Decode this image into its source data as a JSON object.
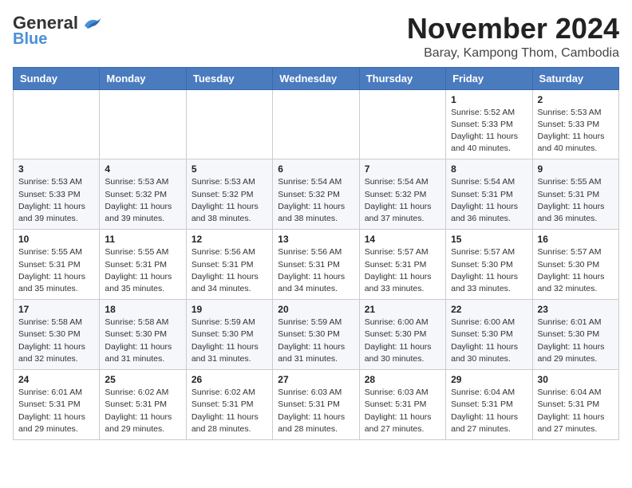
{
  "logo": {
    "general": "General",
    "blue": "Blue"
  },
  "title": "November 2024",
  "location": "Baray, Kampong Thom, Cambodia",
  "weekdays": [
    "Sunday",
    "Monday",
    "Tuesday",
    "Wednesday",
    "Thursday",
    "Friday",
    "Saturday"
  ],
  "weeks": [
    [
      {
        "day": "",
        "info": ""
      },
      {
        "day": "",
        "info": ""
      },
      {
        "day": "",
        "info": ""
      },
      {
        "day": "",
        "info": ""
      },
      {
        "day": "",
        "info": ""
      },
      {
        "day": "1",
        "info": "Sunrise: 5:52 AM\nSunset: 5:33 PM\nDaylight: 11 hours\nand 40 minutes."
      },
      {
        "day": "2",
        "info": "Sunrise: 5:53 AM\nSunset: 5:33 PM\nDaylight: 11 hours\nand 40 minutes."
      }
    ],
    [
      {
        "day": "3",
        "info": "Sunrise: 5:53 AM\nSunset: 5:33 PM\nDaylight: 11 hours\nand 39 minutes."
      },
      {
        "day": "4",
        "info": "Sunrise: 5:53 AM\nSunset: 5:32 PM\nDaylight: 11 hours\nand 39 minutes."
      },
      {
        "day": "5",
        "info": "Sunrise: 5:53 AM\nSunset: 5:32 PM\nDaylight: 11 hours\nand 38 minutes."
      },
      {
        "day": "6",
        "info": "Sunrise: 5:54 AM\nSunset: 5:32 PM\nDaylight: 11 hours\nand 38 minutes."
      },
      {
        "day": "7",
        "info": "Sunrise: 5:54 AM\nSunset: 5:32 PM\nDaylight: 11 hours\nand 37 minutes."
      },
      {
        "day": "8",
        "info": "Sunrise: 5:54 AM\nSunset: 5:31 PM\nDaylight: 11 hours\nand 36 minutes."
      },
      {
        "day": "9",
        "info": "Sunrise: 5:55 AM\nSunset: 5:31 PM\nDaylight: 11 hours\nand 36 minutes."
      }
    ],
    [
      {
        "day": "10",
        "info": "Sunrise: 5:55 AM\nSunset: 5:31 PM\nDaylight: 11 hours\nand 35 minutes."
      },
      {
        "day": "11",
        "info": "Sunrise: 5:55 AM\nSunset: 5:31 PM\nDaylight: 11 hours\nand 35 minutes."
      },
      {
        "day": "12",
        "info": "Sunrise: 5:56 AM\nSunset: 5:31 PM\nDaylight: 11 hours\nand 34 minutes."
      },
      {
        "day": "13",
        "info": "Sunrise: 5:56 AM\nSunset: 5:31 PM\nDaylight: 11 hours\nand 34 minutes."
      },
      {
        "day": "14",
        "info": "Sunrise: 5:57 AM\nSunset: 5:31 PM\nDaylight: 11 hours\nand 33 minutes."
      },
      {
        "day": "15",
        "info": "Sunrise: 5:57 AM\nSunset: 5:30 PM\nDaylight: 11 hours\nand 33 minutes."
      },
      {
        "day": "16",
        "info": "Sunrise: 5:57 AM\nSunset: 5:30 PM\nDaylight: 11 hours\nand 32 minutes."
      }
    ],
    [
      {
        "day": "17",
        "info": "Sunrise: 5:58 AM\nSunset: 5:30 PM\nDaylight: 11 hours\nand 32 minutes."
      },
      {
        "day": "18",
        "info": "Sunrise: 5:58 AM\nSunset: 5:30 PM\nDaylight: 11 hours\nand 31 minutes."
      },
      {
        "day": "19",
        "info": "Sunrise: 5:59 AM\nSunset: 5:30 PM\nDaylight: 11 hours\nand 31 minutes."
      },
      {
        "day": "20",
        "info": "Sunrise: 5:59 AM\nSunset: 5:30 PM\nDaylight: 11 hours\nand 31 minutes."
      },
      {
        "day": "21",
        "info": "Sunrise: 6:00 AM\nSunset: 5:30 PM\nDaylight: 11 hours\nand 30 minutes."
      },
      {
        "day": "22",
        "info": "Sunrise: 6:00 AM\nSunset: 5:30 PM\nDaylight: 11 hours\nand 30 minutes."
      },
      {
        "day": "23",
        "info": "Sunrise: 6:01 AM\nSunset: 5:30 PM\nDaylight: 11 hours\nand 29 minutes."
      }
    ],
    [
      {
        "day": "24",
        "info": "Sunrise: 6:01 AM\nSunset: 5:31 PM\nDaylight: 11 hours\nand 29 minutes."
      },
      {
        "day": "25",
        "info": "Sunrise: 6:02 AM\nSunset: 5:31 PM\nDaylight: 11 hours\nand 29 minutes."
      },
      {
        "day": "26",
        "info": "Sunrise: 6:02 AM\nSunset: 5:31 PM\nDaylight: 11 hours\nand 28 minutes."
      },
      {
        "day": "27",
        "info": "Sunrise: 6:03 AM\nSunset: 5:31 PM\nDaylight: 11 hours\nand 28 minutes."
      },
      {
        "day": "28",
        "info": "Sunrise: 6:03 AM\nSunset: 5:31 PM\nDaylight: 11 hours\nand 27 minutes."
      },
      {
        "day": "29",
        "info": "Sunrise: 6:04 AM\nSunset: 5:31 PM\nDaylight: 11 hours\nand 27 minutes."
      },
      {
        "day": "30",
        "info": "Sunrise: 6:04 AM\nSunset: 5:31 PM\nDaylight: 11 hours\nand 27 minutes."
      }
    ]
  ]
}
